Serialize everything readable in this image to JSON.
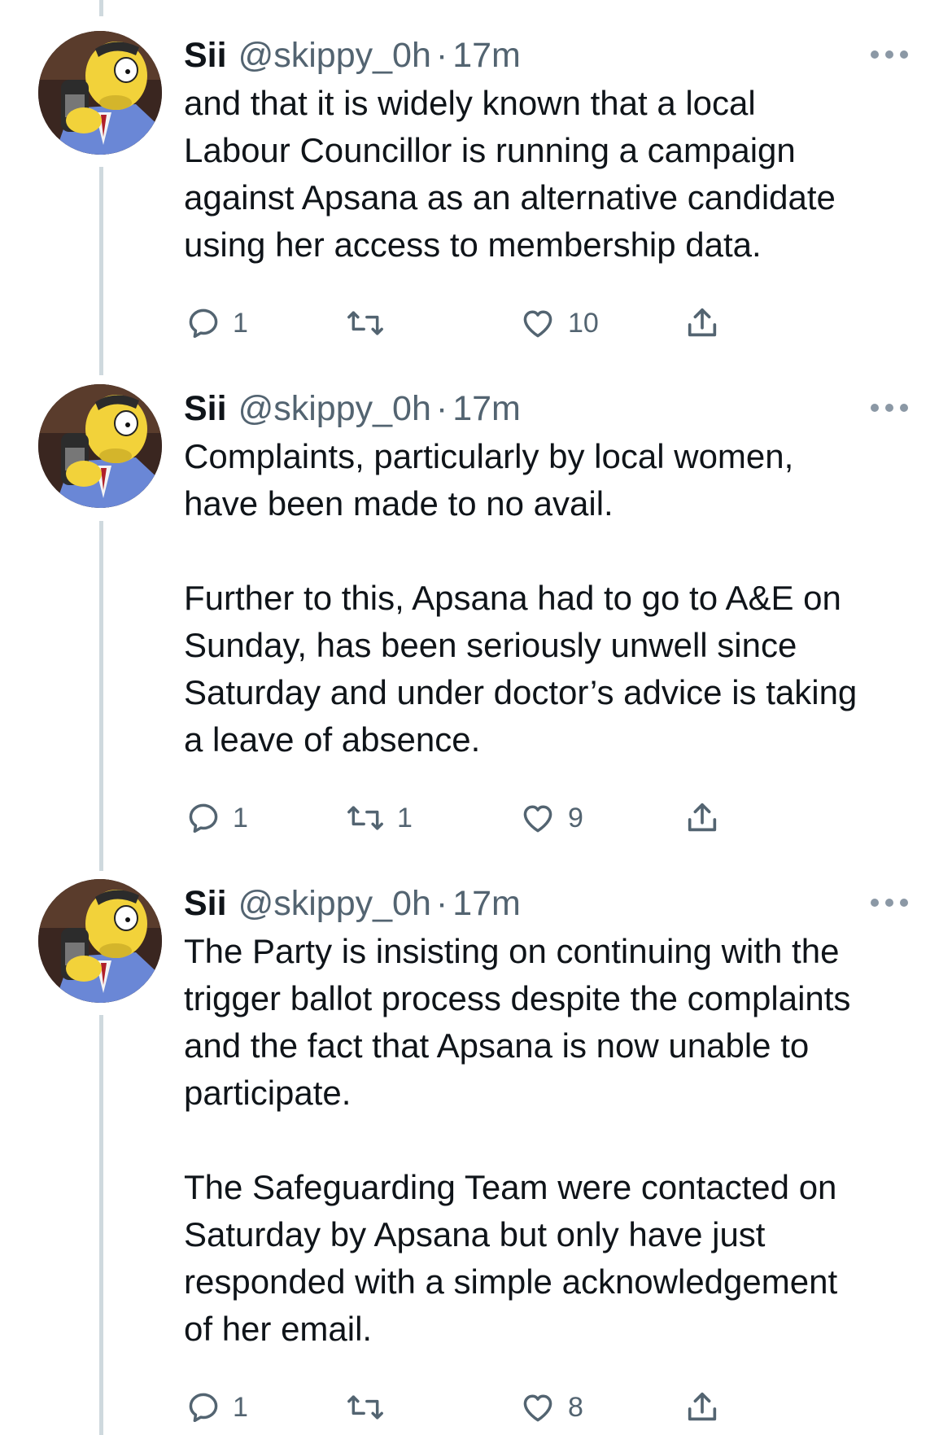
{
  "tweets": [
    {
      "author": "Sii",
      "handle": "@skippy_0h",
      "dot": "·",
      "time": "17m",
      "text": "and that it is widely known that a local\nLabour Councillor is running a campaign\nagainst Apsana as an alternative candidate\nusing her access to membership data.",
      "replies": "1",
      "retweets": "",
      "likes": "10"
    },
    {
      "author": "Sii",
      "handle": "@skippy_0h",
      "dot": "·",
      "time": "17m",
      "text": "Complaints, particularly by local women,\nhave been made to no avail.\n\nFurther to this, Apsana had to go to A&E on\nSunday, has been seriously unwell since\nSaturday and under doctor’s advice is taking\na leave of absence.",
      "replies": "1",
      "retweets": "1",
      "likes": "9"
    },
    {
      "author": "Sii",
      "handle": "@skippy_0h",
      "dot": "·",
      "time": "17m",
      "text": "The Party is insisting on continuing with the\ntrigger ballot process despite the complaints\nand the fact that Apsana is now unable to\nparticipate.\n\nThe Safeguarding Team were contacted on\nSaturday by Apsana but only have just\nresponded with a simple acknowledgement\nof her email.",
      "replies": "1",
      "retweets": "",
      "likes": "8"
    }
  ],
  "icons": {
    "reply": "reply-icon",
    "retweet": "retweet-icon",
    "like": "heart-icon",
    "share": "share-icon",
    "more": "more-icon"
  },
  "colors": {
    "text": "#0f1419",
    "secondary": "#536471",
    "thread_line": "#cfd9de"
  }
}
